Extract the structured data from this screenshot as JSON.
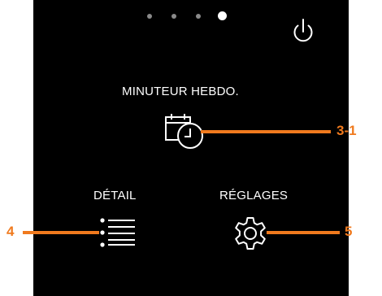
{
  "pagination": {
    "total": 4,
    "active": 3
  },
  "menu": {
    "weekly_timer": {
      "label": "MINUTEUR HEBDO.",
      "icon": "calendar-clock-icon"
    },
    "detail": {
      "label": "DÉTAIL",
      "icon": "list-icon"
    },
    "settings": {
      "label": "RÉGLAGES",
      "icon": "gear-icon"
    }
  },
  "power": {
    "icon": "power-icon"
  },
  "callouts": {
    "weekly_timer": "3-1",
    "detail": "4",
    "settings": "5"
  },
  "colors": {
    "screen": "#000000",
    "foreground": "#ffffff",
    "callout": "#f07a1e",
    "dot_inactive": "#8a8a8a"
  }
}
